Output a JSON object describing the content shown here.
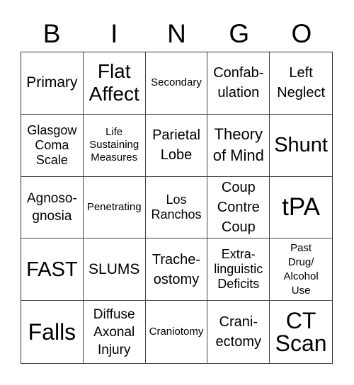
{
  "header": {
    "letters": [
      "B",
      "I",
      "N",
      "G",
      "O"
    ]
  },
  "cells": [
    "Primary",
    "Flat\nAffect",
    "Secondary",
    "Confab-\nulation",
    "Left\nNeglect",
    "Glasgow\nComa\nScale",
    "Life\nSustaining\nMeasures",
    "Parietal\nLobe",
    "Theory\nof Mind",
    "Shunt",
    "Agnoso-\ngnosia",
    "Penetrating",
    "Los\nRanchos",
    "Coup\nContre\nCoup",
    "tPA",
    "FAST",
    "SLUMS",
    "Trache-\nostomy",
    "Extra-\nlinguistic\nDeficits",
    "Past\nDrug/\nAlcohol\nUse",
    "Falls",
    "Diffuse\nAxonal\nInjury",
    "Craniotomy",
    "Crani-\nectomy",
    "CT\nScan"
  ]
}
